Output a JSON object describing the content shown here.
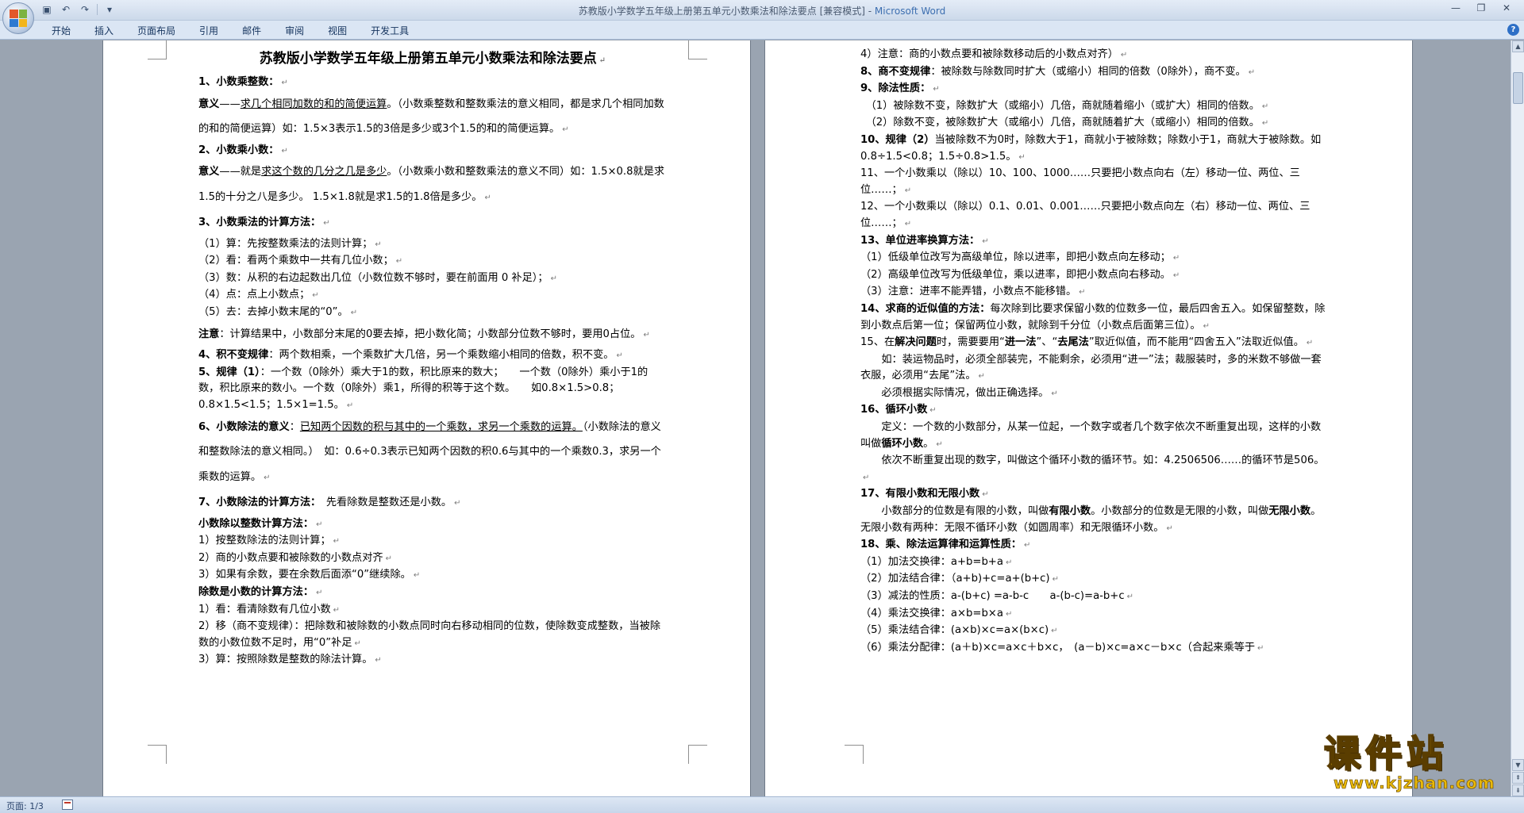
{
  "window": {
    "title": "苏教版小学数学五年级上册第五单元小数乘法和除法要点 [兼容模式] - ",
    "app_name": "Microsoft Word"
  },
  "qat": {
    "save_icon": "save-icon",
    "undo_icon": "undo-icon",
    "redo_icon": "redo-icon",
    "customize_icon": "customize-qat-icon"
  },
  "ribbon": {
    "tabs": [
      "开始",
      "插入",
      "页面布局",
      "引用",
      "邮件",
      "审阅",
      "视图",
      "开发工具"
    ]
  },
  "page1": {
    "title": "苏教版小学数学五年级上册第五单元小数乘法和除法要点",
    "lines": [
      {
        "segments": [
          {
            "t": "1、小数乘整数：",
            "b": true
          }
        ],
        "style": "mid"
      },
      {
        "segments": [
          {
            "t": "意义",
            "b": true
          },
          {
            "t": "——"
          },
          {
            "t": "求几个相同加数的和的简便运算",
            "u": true
          },
          {
            "t": "。（小数乘整数和整数乘法的意义相同，都是求几个相同加数的和的简便运算）如：1.5×3表示1.5的3倍是多少或3个1.5的和的简便运算。"
          }
        ],
        "style": "loose"
      },
      {
        "segments": [
          {
            "t": "2、小数乘小数：",
            "b": true
          }
        ],
        "style": "mid"
      },
      {
        "segments": [
          {
            "t": "意义",
            "b": true
          },
          {
            "t": "——就是"
          },
          {
            "t": "求这个数的几分之几是多少",
            "u": true
          },
          {
            "t": "。（小数乘小数和整数乘法的意义不同）如：1.5×0.8就是求1.5的十分之八是多少。 1.5×1.8就是求1.5的1.8倍是多少。"
          }
        ],
        "style": "loose"
      },
      {
        "segments": [
          {
            "t": "3、小数乘法的计算方法：",
            "b": true
          }
        ],
        "style": "loose"
      },
      {
        "segments": [
          {
            "t": "（1）算：先按整数乘法的法则计算；"
          }
        ],
        "style": "mid"
      },
      {
        "segments": [
          {
            "t": "（2）看：看两个乘数中一共有几位小数；"
          }
        ],
        "style": "mid"
      },
      {
        "segments": [
          {
            "t": "（3）数：从积的右边起数出几位（小数位数不够时，要在前面用 0 补足）；"
          }
        ],
        "style": "mid"
      },
      {
        "segments": [
          {
            "t": "（4）点：点上小数点；"
          }
        ],
        "style": "mid"
      },
      {
        "segments": [
          {
            "t": "（5）去：去掉小数末尾的“0”。"
          }
        ],
        "style": "mid"
      },
      {
        "segments": [
          {
            "t": "注意",
            "b": true
          },
          {
            "t": "：计算结果中，小数部分末尾的0要去掉，把小数化简；小数部分位数不够时，要用0占位。"
          }
        ],
        "style": "loose"
      },
      {
        "segments": [
          {
            "t": "4、积不变规律",
            "b": true
          },
          {
            "t": "：两个数相乘，一个乘数扩大几倍，另一个乘数缩小相同的倍数，积不变。"
          }
        ],
        "style": "mid"
      },
      {
        "segments": [
          {
            "t": "5、规律（1）",
            "b": true
          },
          {
            "t": "：一个数（0除外）乘大于1的数，积比原来的数大；　　一个数（0除外）乘小于1的数，积比原来的数小。一个数（0除外）乘1，所得的积等于这个数。　　如0.8×1.5>0.8；0.8×1.5<1.5；1.5×1=1.5。"
          }
        ],
        "style": "mid"
      },
      {
        "segments": [
          {
            "t": "6、小数除法的意义",
            "b": true
          },
          {
            "t": "："
          },
          {
            "t": "已知两个因数的积与其中的一个乘数，求另一个乘数的运算。",
            "u": true
          },
          {
            "t": "（小数除法的意义和整数除法的意义相同。）　如：0.6÷0.3表示已知两个因数的积0.6与其中的一个乘数0.3，求另一个乘数的运算。"
          }
        ],
        "style": "loose"
      },
      {
        "segments": [
          {
            "t": "7、小数除法的计算方法：",
            "b": true
          },
          {
            "t": "　先看除数是整数还是小数。"
          }
        ],
        "style": "loose"
      },
      {
        "segments": [
          {
            "t": "小数除以整数计算方法：",
            "b": true
          }
        ],
        "style": "mid"
      },
      {
        "segments": [
          {
            "t": "1）按整数除法的法则计算；"
          }
        ],
        "style": "mid"
      },
      {
        "segments": [
          {
            "t": "2）商的小数点要和被除数的小数点对齐"
          }
        ],
        "style": "mid"
      },
      {
        "segments": [
          {
            "t": "3）如果有余数，要在余数后面添“0”继续除。"
          }
        ],
        "style": "mid"
      },
      {
        "segments": [
          {
            "t": "除数是小数的计算方法：",
            "b": true
          }
        ],
        "style": "mid"
      },
      {
        "segments": [
          {
            "t": "1）看：看清除数有几位小数"
          }
        ],
        "style": "mid"
      },
      {
        "segments": [
          {
            "t": "2）移（商不变规律）：把除数和被除数的小数点同时向右移动相同的位数，使除数变成整数，当被除数的小数位数不足时，用“0”补足"
          }
        ],
        "style": "mid"
      },
      {
        "segments": [
          {
            "t": "3）算：按照除数是整数的除法计算。"
          }
        ],
        "style": "mid"
      }
    ]
  },
  "page2": {
    "lines": [
      {
        "segments": [
          {
            "t": "4）注意：商的小数点要和被除数移动后的小数点对齐）"
          }
        ],
        "style": "mid"
      },
      {
        "segments": [
          {
            "t": "8、商不变规律",
            "b": true
          },
          {
            "t": "：被除数与除数同时扩大（或缩小）相同的倍数（0除外），商不变。"
          }
        ],
        "style": "mid"
      },
      {
        "segments": [
          {
            "t": "9、除法性质：",
            "b": true
          }
        ],
        "style": "mid"
      },
      {
        "segments": [
          {
            "t": "　（1）被除数不变，除数扩大（或缩小）几倍，商就随着缩小（或扩大）相同的倍数。"
          }
        ],
        "style": "mid"
      },
      {
        "segments": [
          {
            "t": "　（2）除数不变，被除数扩大（或缩小）几倍，商就随着扩大（或缩小）相同的倍数。"
          }
        ],
        "style": "mid"
      },
      {
        "segments": [
          {
            "t": "10、规律（2）",
            "b": true
          },
          {
            "t": "当被除数不为0时，除数大于1，商就小于被除数；除数小于1，商就大于被除数。如0.8÷1.5<0.8；1.5÷0.8>1.5。"
          }
        ],
        "style": "mid"
      },
      {
        "segments": [
          {
            "t": "11、一个小数乘以（除以）10、100、1000……只要把小数点向右（左）移动一位、两位、三位……；"
          }
        ],
        "style": "mid"
      },
      {
        "segments": [
          {
            "t": "12、一个小数乘以（除以）0.1、0.01、0.001……只要把小数点向左（右）移动一位、两位、三位……；"
          }
        ],
        "style": "mid"
      },
      {
        "segments": [
          {
            "t": "13、单位进率换算方法：",
            "b": true
          }
        ],
        "style": "mid"
      },
      {
        "segments": [
          {
            "t": "（1）低级单位改写为高级单位，除以进率，即把小数点向左移动；"
          }
        ],
        "style": "mid"
      },
      {
        "segments": [
          {
            "t": "（2）高级单位改写为低级单位，乘以进率，即把小数点向右移动。"
          }
        ],
        "style": "mid"
      },
      {
        "segments": [
          {
            "t": "（3）注意：进率不能弄错，小数点不能移错。"
          }
        ],
        "style": "mid"
      },
      {
        "segments": [
          {
            "t": "14、求商的近似值的方法：",
            "b": true
          },
          {
            "t": "每次除到比要求保留小数的位数多一位，最后四舍五入。如保留整数，除到小数点后第一位；保留两位小数，就除到千分位（小数点后面第三位）。"
          }
        ],
        "style": "mid"
      },
      {
        "segments": [
          {
            "t": "15、在"
          },
          {
            "t": "解决问题",
            "b": true
          },
          {
            "t": "时，需要要用“"
          },
          {
            "t": "进一法",
            "b": true
          },
          {
            "t": "”、“"
          },
          {
            "t": "去尾法",
            "b": true
          },
          {
            "t": "”取近似值，而不能用“四舍五入”法取近似值。"
          }
        ],
        "style": "mid"
      },
      {
        "segments": [
          {
            "t": "　　如：装运物品时，必须全部装完，不能剩余，必须用“进一”法；裁服装时，多的米数不够做一套衣服，必须用“去尾”法。"
          }
        ],
        "style": "mid"
      },
      {
        "segments": [
          {
            "t": "　　必须根据实际情况，做出正确选择。"
          }
        ],
        "style": "mid"
      },
      {
        "segments": [
          {
            "t": "16、循环小数",
            "b": true
          }
        ],
        "style": "mid"
      },
      {
        "segments": [
          {
            "t": "　　定义：一个数的小数部分，从某一位起，一个数字或者几个数字依次不断重复出现，这样的小数叫做"
          },
          {
            "t": "循环小数",
            "b": true
          },
          {
            "t": "。"
          }
        ],
        "style": "mid"
      },
      {
        "segments": [
          {
            "t": "　　依次不断重复出现的数字，叫做这个循环小数的循环节。如：4.2506506……的循环节是506。"
          }
        ],
        "style": "mid"
      },
      {
        "segments": [
          {
            "t": "17、有限小数和无限小数",
            "b": true
          }
        ],
        "style": "mid"
      },
      {
        "segments": [
          {
            "t": "　　小数部分的位数是有限的小数，叫做"
          },
          {
            "t": "有限小数",
            "b": true
          },
          {
            "t": "。小数部分的位数是无限的小数，叫做"
          },
          {
            "t": "无限小数",
            "b": true
          },
          {
            "t": "。无限小数有两种：无限不循环小数（如圆周率）和无限循环小数。"
          }
        ],
        "style": "mid"
      },
      {
        "segments": [
          {
            "t": "18、乘、除法运算律和运算性质：",
            "b": true
          }
        ],
        "style": "mid"
      },
      {
        "segments": [
          {
            "t": "（1）加法交换律：a+b=b+a"
          }
        ],
        "style": "mid"
      },
      {
        "segments": [
          {
            "t": "（2）加法结合律：（a+b)+c=a+(b+c)"
          }
        ],
        "style": "mid"
      },
      {
        "segments": [
          {
            "t": "（3）减法的性质：a-(b+c) =a-b-c　　a-(b-c)=a-b+c"
          }
        ],
        "style": "mid"
      },
      {
        "segments": [
          {
            "t": "（4）乘法交换律：a×b=b×a"
          }
        ],
        "style": "mid"
      },
      {
        "segments": [
          {
            "t": "（5）乘法结合律：(a×b)×c=a×(b×c)"
          }
        ],
        "style": "mid"
      },
      {
        "segments": [
          {
            "t": "（6）乘法分配律：(a＋b)×c=a×c＋b×c，　(a－b)×c=a×c－b×c（合起来乘等于"
          }
        ],
        "style": "mid"
      }
    ]
  },
  "paragraph_mark": "↵",
  "status": {
    "page": "页面: 1/3"
  },
  "watermark": {
    "main": "课件站",
    "url": "www.kjzhan.com"
  },
  "colors": {
    "app_name": "#3d6fb0",
    "watermark": "#f4c20d",
    "workspace": "#9aa4b1"
  }
}
